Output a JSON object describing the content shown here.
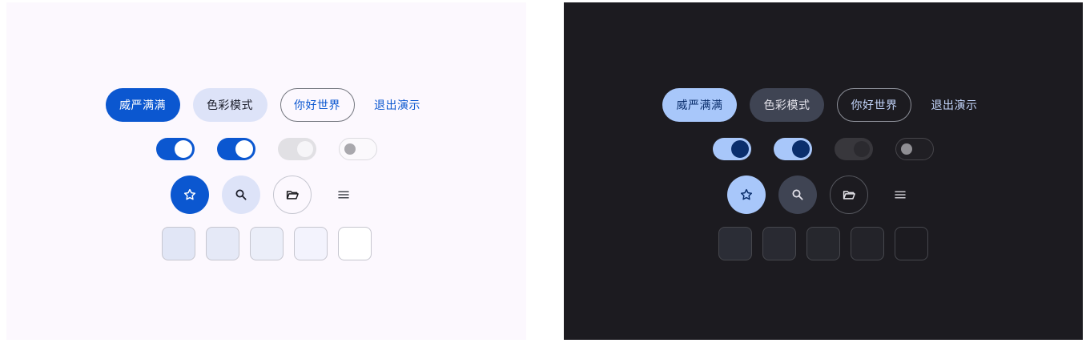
{
  "panels": {
    "light": {
      "buttons": {
        "filled": "威严满满",
        "tonal": "色彩模式",
        "outlined": "你好世界",
        "text": "退出演示"
      }
    },
    "dark": {
      "buttons": {
        "filled": "威严满满",
        "tonal": "色彩模式",
        "outlined": "你好世界",
        "text": "退出演示"
      }
    }
  },
  "switches": [
    {
      "state": "on",
      "enabled": true
    },
    {
      "state": "on",
      "enabled": true
    },
    {
      "state": "on",
      "enabled": false
    },
    {
      "state": "off",
      "enabled": false
    }
  ],
  "icon_buttons": [
    "star-icon",
    "search-icon",
    "folder-open-icon",
    "menu-icon"
  ],
  "surface_tiles": [
    "surface-container-highest",
    "surface-container-high",
    "surface-container",
    "surface-container-low",
    "surface-container-lowest"
  ],
  "colors": {
    "light_background": "#fcf8fe",
    "light_primary": "#0b57d0",
    "light_secondary_container": "#dde3f8",
    "dark_background": "#1c1b20",
    "dark_primary": "#a8c7fa",
    "dark_on_primary": "#0a2e6c",
    "dark_secondary_container": "#3f4453"
  }
}
